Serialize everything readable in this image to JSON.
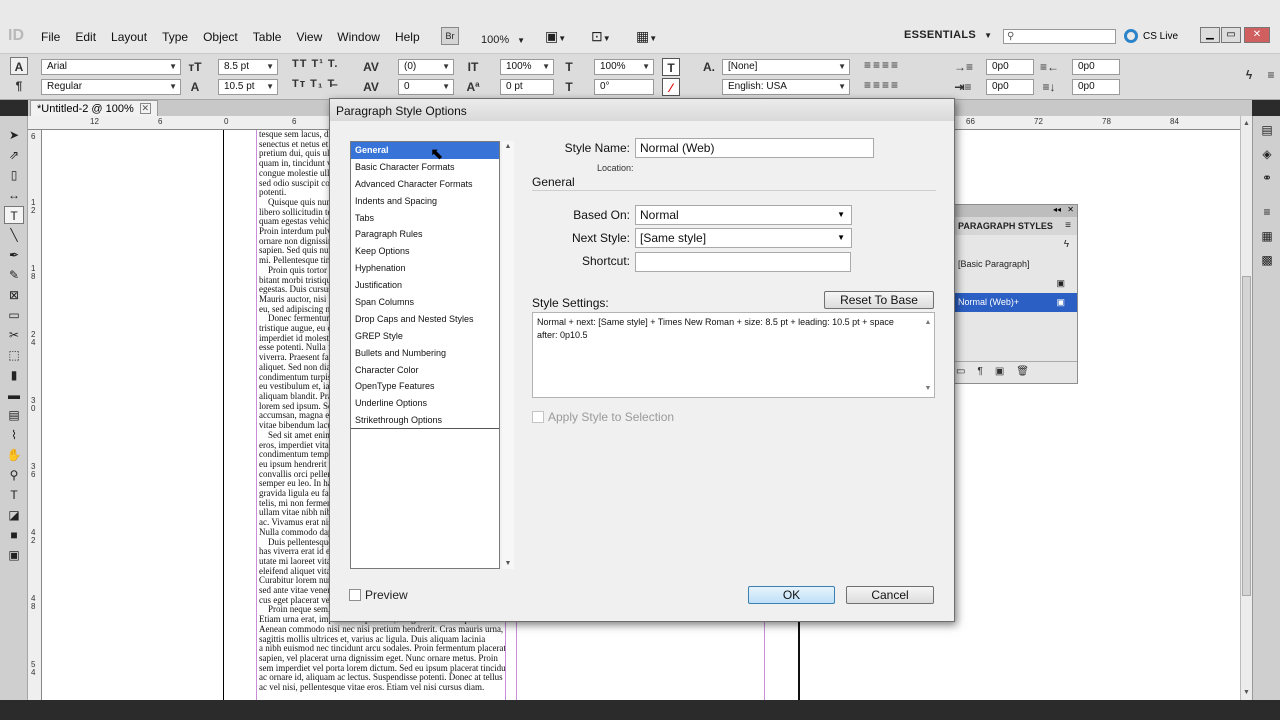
{
  "app": {
    "logo": "ID",
    "menu": [
      "File",
      "Edit",
      "Layout",
      "Type",
      "Object",
      "Table",
      "View",
      "Window",
      "Help"
    ],
    "bridge_label": "Br",
    "zoom": "100%",
    "workspace": "ESSENTIALS",
    "cs_live": "CS Live"
  },
  "control_panel": {
    "font_family": "Arial",
    "font_style": "Regular",
    "font_size": "8.5 pt",
    "leading": "10.5 pt",
    "kerning": "(0)",
    "tracking": "0",
    "vertical_scale": "100%",
    "baseline_shift": "0 pt",
    "horizontal_scale": "100%",
    "skew": "0°",
    "char_style": "[None]",
    "language": "English: USA",
    "indent_left": "0p0",
    "indent_first": "0p0",
    "indent_right": "0p0",
    "space_after": "0p0"
  },
  "document": {
    "tab_title": "*Untitled-2 @ 100%",
    "ruler_h": [
      "12",
      "6",
      "0",
      "6",
      "66",
      "72",
      "78",
      "84"
    ],
    "ruler_v": [
      "6",
      "1",
      "2",
      "1",
      "8",
      "2",
      "4",
      "3",
      "0",
      "3",
      "6",
      "4",
      "2",
      "4",
      "8",
      "5",
      "4",
      "6",
      "0"
    ],
    "body_text": [
      "tesque sem lacus, dictum",
      "senectus et netus et malesuada",
      "pretium dui, quis ullamcorper",
      "quam in, tincidunt vestibulum",
      "congue molestie ullamcorper",
      "sed odio suscipit condimentum",
      "potenti.",
      "    Quisque quis nunc vitae",
      "libero sollicitudin tempus ut",
      "quam egestas vehicula mauris",
      "Proin interdum pulvinar mi id",
      "ornare non dignissim lectus",
      "sapien. Sed quis nunc eget",
      "mi. Pellentesque tincidunt",
      "    Proin quis tortor orci",
      "bitant morbi tristique senectus",
      "egestas. Duis cursus sem ut",
      "Mauris auctor, nisi eget rhoncus",
      "eu, sed adipiscing nunc. Aliquam",
      "    Donec fermentum arcu sit",
      "tristique augue, eu commodo",
      "imperdiet id molestie vitae",
      "esse potenti. Nulla facilisi",
      "viverra. Praesent faucibus",
      "aliquet. Sed non diam quis",
      "condimentum turpis. Nullam",
      "eu vestibulum et, iaculis",
      "aliquam blandit. Praesent",
      "lorem sed ipsum. Sed iaculis",
      "accumsan, magna eget luctus",
      "vitae bibendum lacus.",
      "    Sed sit amet enim vel",
      "eros, imperdiet vitae viverra",
      "condimentum tempus. Nulla",
      "eu ipsum hendrerit vitae eget",
      "convallis orci pellentesque",
      "semper eu leo. In hac habitasse",
      "gravida ligula eu facilisis",
      "telis, mi non fermentum",
      "ullam vitae nibh nibh. Etiam",
      "ac. Vivamus erat nisi, tempor",
      "Nulla commodo dapibus enim",
      "    Duis pellentesque mauris",
      "has viverra erat id est",
      "utate mi laoreet vitae",
      "eleifend aliquet vitae",
      "Curabitur lorem nunc",
      "sed ante vitae venenatis",
      "cus eget placerat vel.",
      "    Proin neque sem, suscipit sed tincidunt at, cursus",
      "Etiam urna erat, imperdiet in porta ac, congue sit amet sapien.",
      "Aenean commodo nisi nec nisi pretium hendrerit. Cras mauris urna,",
      "sagittis mollis ultrices et, varius ac ligula. Duis aliquam lacinia",
      "a nibh euismod nec tincidunt arcu sodales. Proin fermentum placerat",
      "sapien, vel placerat urna dignissim eget. Nunc ornare metus. Proin",
      "sem imperdiet vel porta lorem dictum. Sed eu ipsum placerat tincidunt",
      "ac ornare id, aliquam ac lectus. Suspendisse potenti. Donec at tellus",
      "ac vel nisi, pellentesque vitae eros. Etiam vel nisi cursus diam."
    ]
  },
  "paragraph_styles_panel": {
    "title": "PARAGRAPH STYLES",
    "items": [
      "[Basic Paragraph]",
      "",
      "Normal (Web)+"
    ]
  },
  "dialog": {
    "title": "Paragraph Style Options",
    "categories": [
      "General",
      "Basic Character Formats",
      "Advanced Character Formats",
      "Indents and Spacing",
      "Tabs",
      "Paragraph Rules",
      "Keep Options",
      "Hyphenation",
      "Justification",
      "Span Columns",
      "Drop Caps and Nested Styles",
      "GREP Style",
      "Bullets and Numbering",
      "Character Color",
      "OpenType Features",
      "Underline Options",
      "Strikethrough Options"
    ],
    "selected_category": "General",
    "style_name_label": "Style Name:",
    "style_name_value": "Normal (Web)",
    "location_label": "Location:",
    "section_general": "General",
    "based_on_label": "Based On:",
    "based_on_value": "Normal",
    "next_style_label": "Next Style:",
    "next_style_value": "[Same style]",
    "shortcut_label": "Shortcut:",
    "shortcut_value": "",
    "style_settings_label": "Style Settings:",
    "reset_button": "Reset To Base",
    "style_settings_text": "Normal + next: [Same style] + Times New Roman + size: 8.5 pt + leading: 10.5 pt + space after: 0p10.5",
    "apply_style_label": "Apply Style to Selection",
    "apply_style_checked": false,
    "preview_label": "Preview",
    "preview_checked": false,
    "ok_button": "OK",
    "cancel_button": "Cancel"
  },
  "colors": {
    "selection_blue": "#3874d8",
    "panel_selection": "#2b5fc4",
    "guide_magenta": "#c88cd8"
  }
}
